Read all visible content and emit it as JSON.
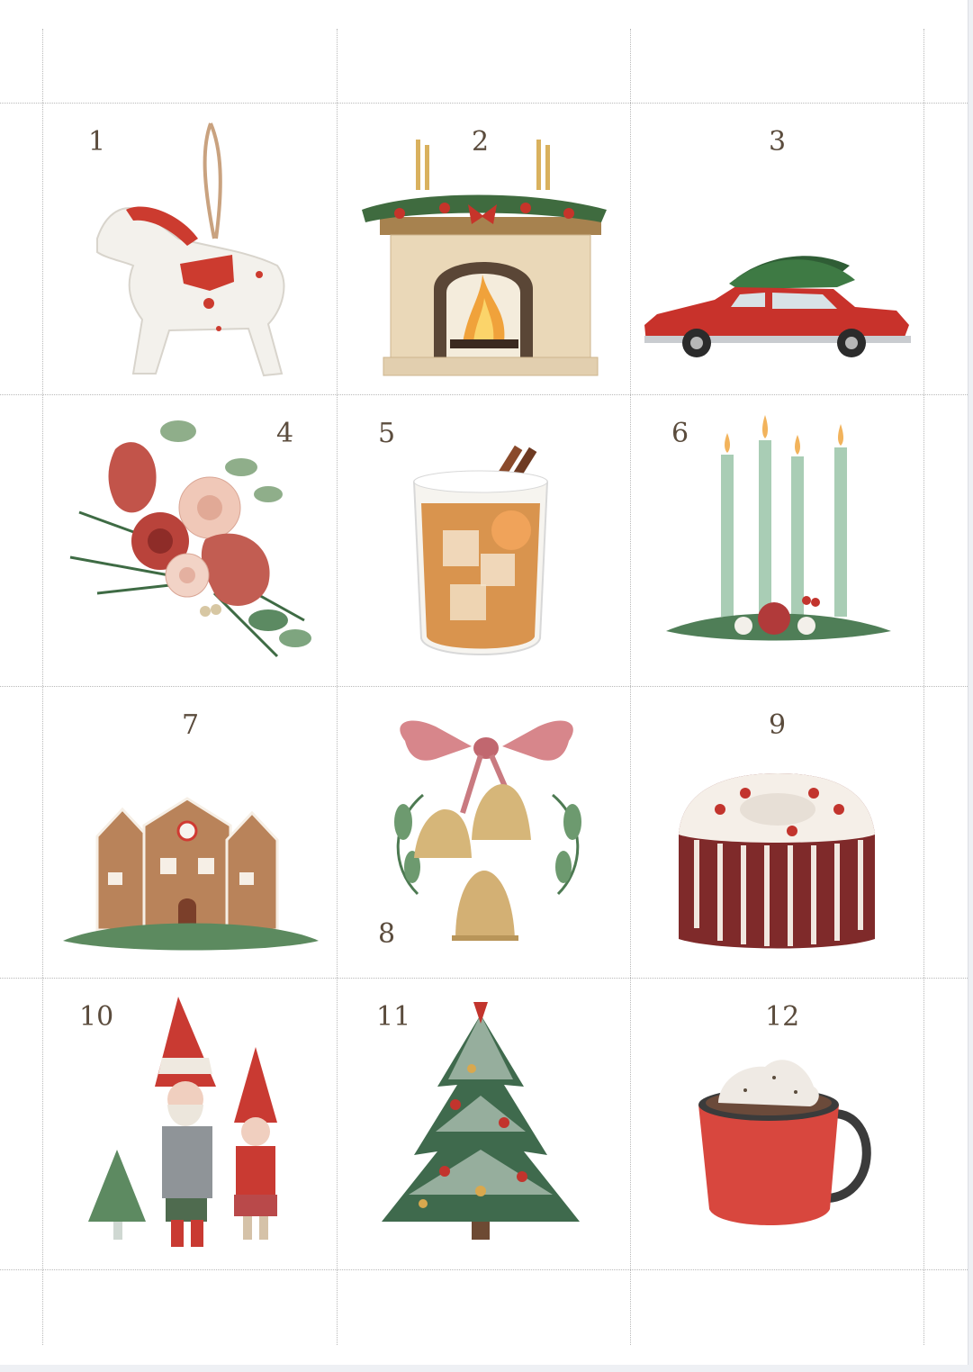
{
  "cards": [
    {
      "number": "1",
      "icon": "horse-ornament-icon"
    },
    {
      "number": "2",
      "icon": "fireplace-icon"
    },
    {
      "number": "3",
      "icon": "car-with-tree-icon"
    },
    {
      "number": "4",
      "icon": "floral-bouquet-icon"
    },
    {
      "number": "5",
      "icon": "cinnamon-drink-icon"
    },
    {
      "number": "6",
      "icon": "advent-candles-icon"
    },
    {
      "number": "7",
      "icon": "gingerbread-houses-icon"
    },
    {
      "number": "8",
      "icon": "bells-with-bow-icon"
    },
    {
      "number": "9",
      "icon": "bundt-cake-icon"
    },
    {
      "number": "10",
      "icon": "gnome-couple-icon"
    },
    {
      "number": "11",
      "icon": "christmas-tree-icon"
    },
    {
      "number": "12",
      "icon": "hot-cocoa-mug-icon"
    }
  ]
}
